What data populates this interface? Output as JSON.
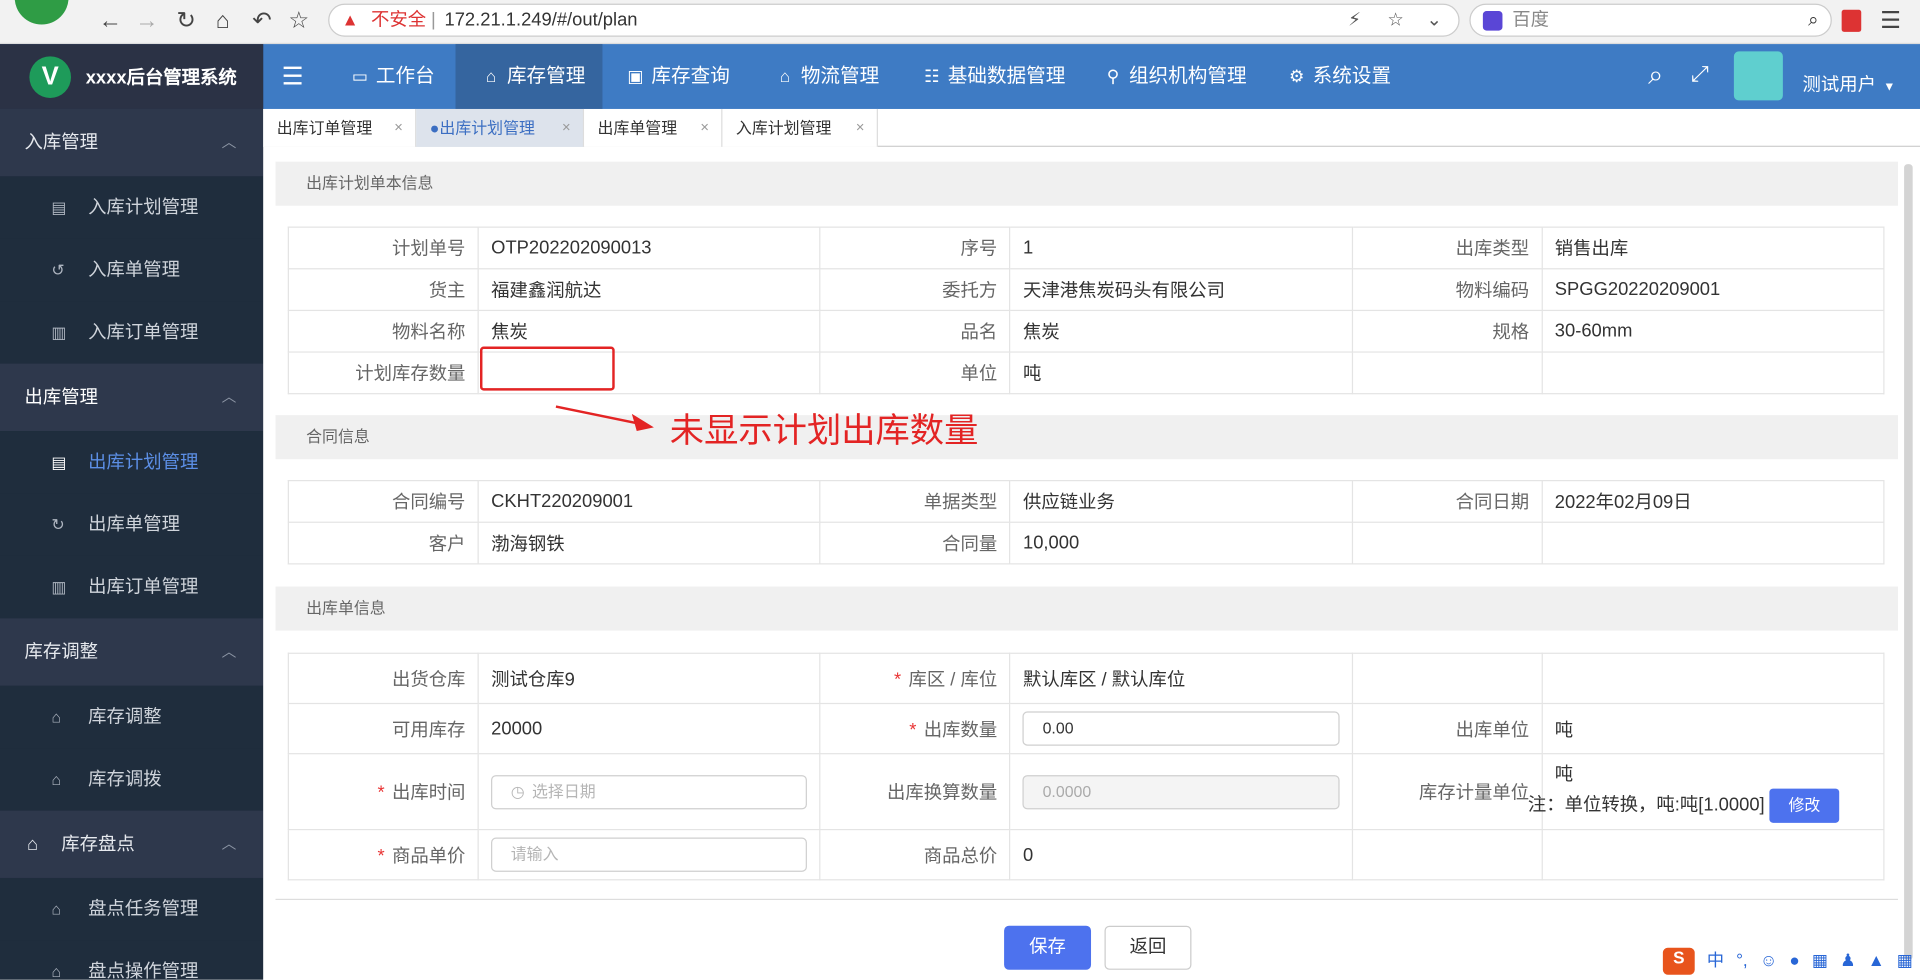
{
  "browser": {
    "insecure_label": "不安全",
    "url": "172.21.1.249/#/out/plan",
    "search_engine": "百度"
  },
  "app": {
    "logo_letter": "V",
    "title": "xxxx后台管理系统",
    "user": "测试用户"
  },
  "nav": [
    "工作台",
    "库存管理",
    "库存查询",
    "物流管理",
    "基础数据管理",
    "组织机构管理",
    "系统设置"
  ],
  "sidebar": {
    "groups": [
      {
        "label": "入库管理",
        "items": [
          "入库计划管理",
          "入库单管理",
          "入库订单管理"
        ]
      },
      {
        "label": "出库管理",
        "items": [
          "出库计划管理",
          "出库单管理",
          "出库订单管理"
        ]
      },
      {
        "label": "库存调整",
        "items": [
          "库存调整",
          "库存调拨"
        ]
      },
      {
        "label": "库存盘点",
        "items": [
          "盘点任务管理",
          "盘点操作管理"
        ]
      }
    ],
    "active_item": "出库计划管理"
  },
  "tabs": [
    "出库订单管理",
    "出库计划管理",
    "出库单管理",
    "入库计划管理"
  ],
  "sections": {
    "plan": "出库计划单本信息",
    "contract": "合同信息",
    "order": "出库单信息"
  },
  "plan": {
    "plan_no_label": "计划单号",
    "plan_no": "OTP202202090013",
    "seq_label": "序号",
    "seq": "1",
    "out_type_label": "出库类型",
    "out_type": "销售出库",
    "owner_label": "货主",
    "owner": "福建鑫润航达",
    "consignor_label": "委托方",
    "consignor": "天津港焦炭码头有限公司",
    "material_code_label": "物料编码",
    "material_code": "SPGG20220209001",
    "material_name_label": "物料名称",
    "material_name": "焦炭",
    "product_label": "品名",
    "product": "焦炭",
    "spec_label": "规格",
    "spec": "30-60mm",
    "plan_qty_label": "计划库存数量",
    "plan_qty": "",
    "unit_label": "单位",
    "unit": "吨"
  },
  "contract": {
    "no_label": "合同编号",
    "no": "CKHT220209001",
    "doc_type_label": "单据类型",
    "doc_type": "供应链业务",
    "date_label": "合同日期",
    "date": "2022年02月09日",
    "customer_label": "客户",
    "customer": "渤海钢铁",
    "amount_label": "合同量",
    "amount": "10,000"
  },
  "order": {
    "warehouse_label": "出货仓库",
    "warehouse": "测试仓库9",
    "location_label": "库区 / 库位",
    "location": "默认库区 / 默认库位",
    "available_label": "可用库存",
    "available": "20000",
    "out_qty_label": "出库数量",
    "out_qty": "0.00",
    "out_unit_label": "出库单位",
    "out_unit": "吨",
    "out_time_label": "出库时间",
    "out_time_placeholder": "选择日期",
    "conv_qty_label": "出库换算数量",
    "conv_qty": "0.0000",
    "stock_unit_label": "库存计量单位",
    "stock_unit": "吨",
    "note": "注：单位转换，吨:吨[1.0000]",
    "modify": "修改",
    "price_label": "商品单价",
    "price_placeholder": "请输入",
    "total_label": "商品总价",
    "total": "0"
  },
  "buttons": {
    "save": "保存",
    "back": "返回"
  },
  "annotation": "未显示计划出库数量",
  "ime_label": "中"
}
